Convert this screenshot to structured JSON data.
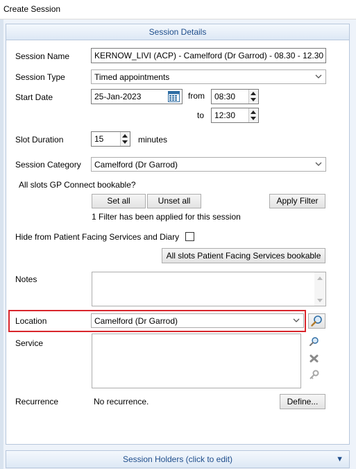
{
  "window": {
    "title": "Create Session"
  },
  "panel": {
    "header": "Session Details"
  },
  "fields": {
    "session_name": {
      "label": "Session Name",
      "value": "KERNOW_LIVI (ACP) - Camelford (Dr Garrod) - 08.30 - 12.30"
    },
    "session_type": {
      "label": "Session Type",
      "value": "Timed appointments"
    },
    "start_date": {
      "label": "Start Date",
      "value": "25-Jan-2023"
    },
    "from": {
      "label": "from",
      "value": "08:30"
    },
    "to": {
      "label": "to",
      "value": "12:30"
    },
    "slot_duration": {
      "label": "Slot Duration",
      "value": "15",
      "unit": "minutes"
    },
    "session_category": {
      "label": "Session Category",
      "value": "Camelford (Dr Garrod)"
    },
    "gp_connect": {
      "label": "All slots GP Connect bookable?",
      "set_all": "Set all",
      "unset_all": "Unset all",
      "apply_filter": "Apply Filter",
      "filter_status": "1 Filter has been applied for this session"
    },
    "hide_pfs": {
      "label": "Hide from Patient Facing Services and Diary",
      "checked": false
    },
    "pfs_bookable_button": "All slots Patient Facing Services bookable",
    "notes": {
      "label": "Notes",
      "value": ""
    },
    "location": {
      "label": "Location",
      "value": "Camelford (Dr Garrod)"
    },
    "service": {
      "label": "Service"
    },
    "recurrence": {
      "label": "Recurrence",
      "value": "No recurrence.",
      "define_button": "Define..."
    }
  },
  "footer": {
    "header": "Session Holders (click to edit)"
  },
  "colors": {
    "accent": "#1f4e8c",
    "highlight": "#d9262c"
  },
  "icons": [
    "calendar-icon",
    "chevron-down-icon",
    "search-icon",
    "remove-icon",
    "key-icon",
    "double-chevron-down-icon"
  ]
}
